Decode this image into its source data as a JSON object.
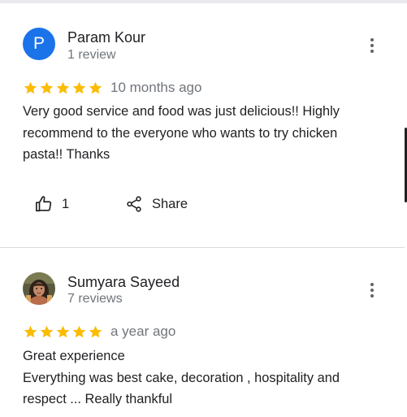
{
  "colors": {
    "star": "#fbbc04",
    "avatar_bg": "#1a73e8",
    "secondary_text": "#70757a",
    "divider": "#dadce0"
  },
  "reviews": [
    {
      "avatar_letter": "P",
      "name": "Param Kour",
      "review_count": "1 review",
      "rating": 5,
      "date": "10 months ago",
      "text_lines": [
        "Very good service and food was just delicious!! Highly",
        "recommend to the everyone who wants to try chicken",
        "pasta!! Thanks"
      ],
      "like_count": "1",
      "share_label": "Share",
      "like_icon": "thumbs-up-icon",
      "share_icon": "share-icon",
      "more_icon": "more-vert-icon"
    },
    {
      "avatar_icon": "profile-photo",
      "name": "Sumyara Sayeed",
      "review_count": "7 reviews",
      "rating": 5,
      "date": "a year ago",
      "text_lines": [
        "Great experience",
        "Everything was best cake, decoration , hospitality and",
        "respect ... Really thankful"
      ],
      "more_icon": "more-vert-icon"
    }
  ]
}
